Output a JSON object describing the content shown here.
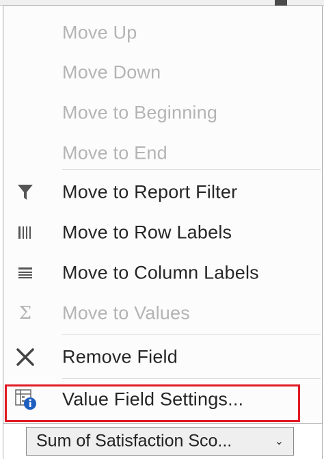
{
  "menu": {
    "items": [
      {
        "label": "Move Up",
        "enabled": false,
        "icon": ""
      },
      {
        "label": "Move Down",
        "enabled": false,
        "icon": ""
      },
      {
        "label": "Move to Beginning",
        "enabled": false,
        "icon": ""
      },
      {
        "label": "Move to End",
        "enabled": false,
        "icon": ""
      },
      {
        "label": "Move to Report Filter",
        "enabled": true,
        "icon": "filter-icon"
      },
      {
        "label": "Move to Row Labels",
        "enabled": true,
        "icon": "row-labels-icon"
      },
      {
        "label": "Move to Column Labels",
        "enabled": true,
        "icon": "column-labels-icon"
      },
      {
        "label": "Move to Values",
        "enabled": false,
        "icon": "sigma-icon",
        "icon_glyph": "Σ"
      },
      {
        "label": "Remove Field",
        "enabled": true,
        "icon": "remove-x-icon"
      },
      {
        "label": "Value Field Settings...",
        "enabled": true,
        "icon": "field-settings-info-icon",
        "highlighted": true,
        "highlight_color": "#e01b24"
      }
    ]
  },
  "field_button": {
    "label": "Sum of Satisfaction Sco...",
    "arrow": "⌄"
  },
  "colors": {
    "disabled_text": "#b4b4b4",
    "enabled_text": "#262626",
    "highlight": "#e01b24",
    "info_blue": "#1f5fbf"
  }
}
